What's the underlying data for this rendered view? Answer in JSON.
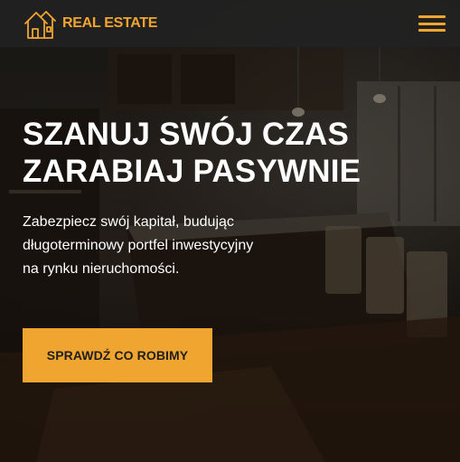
{
  "header": {
    "brand_name": "REAL ESTATE",
    "logo_icon": "house-outline-icon",
    "menu_icon": "hamburger-menu-icon"
  },
  "hero": {
    "title_line1": "SZANUJ SWÓJ CZAS",
    "title_line2": "ZARABIAJ PASYWNIE",
    "description": "Zabezpiecz swój kapitał, budując długoterminowy portfel inwestycyjny na rynku nieruchomości.",
    "cta_label": "SPRAWDŹ CO ROBIMY",
    "background_image": "dark-kitchen-interior-photo"
  },
  "colors": {
    "accent": "#f0a530",
    "header_bg": "#222222",
    "text": "#ffffff"
  }
}
